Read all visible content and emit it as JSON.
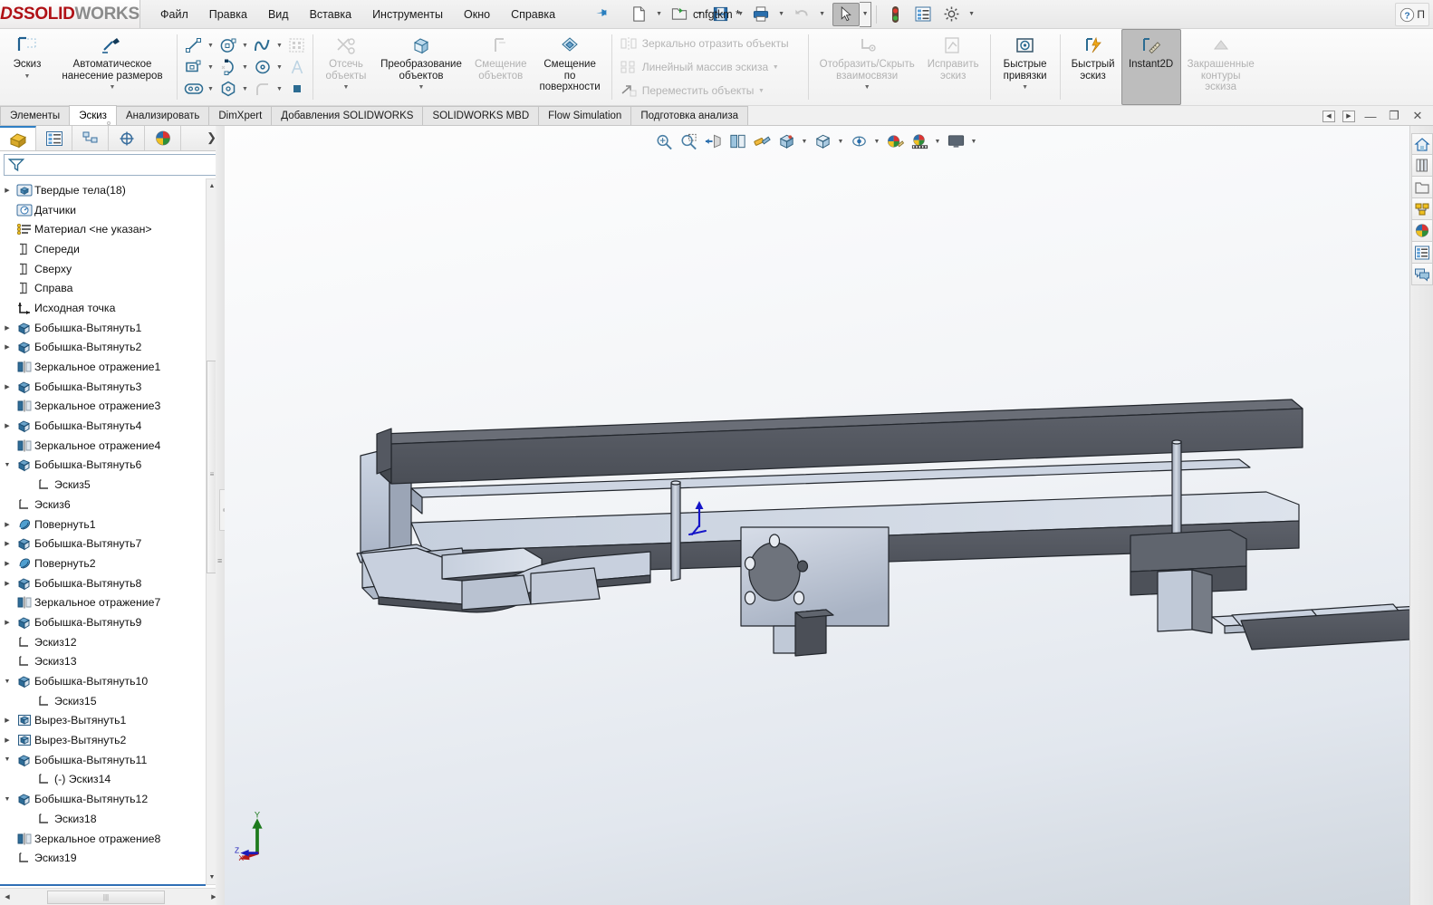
{
  "app": {
    "logo_ds": "DS",
    "logo_solid": "SOLID",
    "logo_works": "WORKS",
    "document_title": "cnfgtkm *"
  },
  "menu": {
    "items": [
      {
        "label": "Файл"
      },
      {
        "label": "Правка"
      },
      {
        "label": "Вид"
      },
      {
        "label": "Вставка"
      },
      {
        "label": "Инструменты"
      },
      {
        "label": "Окно"
      },
      {
        "label": "Справка"
      }
    ],
    "pin_icon": "pushpin-icon"
  },
  "quick_access": {
    "buttons": [
      {
        "name": "new-document-button",
        "icon": "new-file-icon",
        "caret": true
      },
      {
        "name": "open-document-button",
        "icon": "open-folder-icon",
        "caret": true
      },
      {
        "name": "save-document-button",
        "icon": "floppy-save-icon",
        "caret": true
      },
      {
        "name": "print-button",
        "icon": "printer-icon",
        "caret": true
      },
      {
        "name": "undo-button",
        "icon": "undo-arrow-icon",
        "caret": true,
        "disabled": true
      },
      {
        "name": "select-button",
        "icon": "mouse-cursor-icon",
        "caret": true,
        "selected": true
      },
      {
        "name": "rebuild-button",
        "icon": "traffic-light-icon",
        "caret": false
      },
      {
        "name": "options-list-button",
        "icon": "list-properties-icon",
        "caret": false
      },
      {
        "name": "settings-button",
        "icon": "gear-icon",
        "caret": true
      }
    ]
  },
  "help_bar": {
    "help_icon": "question-circle-icon",
    "label": "П"
  },
  "ribbon": {
    "groups": [
      {
        "name": "sketch-group",
        "big_buttons": [
          {
            "label": "Эскиз",
            "icon": "sketch-corner-icon",
            "caret": true,
            "disabled": false
          },
          {
            "label": "Автоматическое\nнанесение размеров",
            "icon": "smart-dimension-icon",
            "caret": true,
            "disabled": false
          }
        ]
      },
      {
        "name": "sketch-entities-group",
        "icon_rows": [
          [
            {
              "icon": "line-icon",
              "caret": true
            },
            {
              "icon": "circle-icon",
              "caret": true
            },
            {
              "icon": "spline-icon",
              "caret": true
            },
            {
              "icon": "sketch-pattern-icon",
              "caret": false
            }
          ],
          [
            {
              "icon": "rectangle-icon",
              "caret": true
            },
            {
              "icon": "arc-icon",
              "caret": true
            },
            {
              "icon": "ellipse-icon",
              "caret": true
            },
            {
              "icon": "text-icon",
              "caret": false
            }
          ],
          [
            {
              "icon": "slot-icon",
              "caret": true
            },
            {
              "icon": "polygon-icon",
              "caret": true
            },
            {
              "icon": "fillet-icon",
              "caret": true
            },
            {
              "icon": "point-icon",
              "caret": false
            }
          ]
        ]
      },
      {
        "name": "trim-group",
        "big_buttons": [
          {
            "label": "Отсечь\nобъекты",
            "icon": "trim-entities-icon",
            "caret": true,
            "disabled": true
          },
          {
            "label": "Преобразование\nобъектов",
            "icon": "convert-entities-icon",
            "caret": true,
            "disabled": false
          },
          {
            "label": "Смещение\nобъектов",
            "icon": "offset-entities-icon",
            "caret": false,
            "disabled": true
          },
          {
            "label": "Смещение\nпо\nповерхности",
            "icon": "offset-on-surface-icon",
            "caret": false,
            "disabled": false
          }
        ]
      },
      {
        "name": "pattern-group",
        "label_rows": [
          {
            "label": "Зеркально отразить объекты",
            "icon": "mirror-entities-icon",
            "caret": false,
            "disabled": true
          },
          {
            "label": "Линейный массив эскиза",
            "icon": "linear-pattern-icon",
            "caret": true,
            "disabled": true
          },
          {
            "label": "Переместить объекты",
            "icon": "move-entities-icon",
            "caret": true,
            "disabled": true
          }
        ]
      },
      {
        "name": "relations-group",
        "big_buttons": [
          {
            "label": "Отобразить/Скрыть\nвзаимосвязи",
            "icon": "display-relations-icon",
            "caret": true,
            "disabled": true
          },
          {
            "label": "Исправить\nэскиз",
            "icon": "repair-sketch-icon",
            "caret": false,
            "disabled": true
          }
        ]
      },
      {
        "name": "snaps-group",
        "big_buttons": [
          {
            "label": "Быстрые\nпривязки",
            "icon": "quick-snaps-icon",
            "caret": true,
            "disabled": false
          }
        ]
      },
      {
        "name": "instant-group",
        "big_buttons": [
          {
            "label": "Быстрый\nэскиз",
            "icon": "rapid-sketch-icon",
            "caret": false,
            "disabled": false
          },
          {
            "label": "Instant2D",
            "icon": "instant2d-icon",
            "caret": false,
            "disabled": false,
            "selected": true
          },
          {
            "label": "Закрашенные\nконтуры\nэскиза",
            "icon": "shaded-sketch-contours-icon",
            "caret": false,
            "disabled": true
          }
        ]
      }
    ]
  },
  "command_tabs": {
    "items": [
      {
        "label": "Элементы",
        "active": false
      },
      {
        "label": "Эскиз",
        "active": true
      },
      {
        "label": "Анализировать",
        "active": false
      },
      {
        "label": "DimXpert",
        "active": false
      },
      {
        "label": "Добавления SOLIDWORKS",
        "active": false
      },
      {
        "label": "SOLIDWORKS MBD",
        "active": false
      },
      {
        "label": "Flow Simulation",
        "active": false
      },
      {
        "label": "Подготовка анализа",
        "active": false
      }
    ],
    "window_controls": [
      {
        "name": "prev-arrow-button",
        "glyph": "◀"
      },
      {
        "name": "next-arrow-button",
        "glyph": "▶"
      },
      {
        "name": "minimize-button",
        "glyph": "—"
      },
      {
        "name": "restore-button",
        "glyph": "❐"
      },
      {
        "name": "close-button",
        "glyph": "✕"
      }
    ]
  },
  "feature_manager": {
    "tabs": [
      {
        "name": "feature-tree-tab",
        "icon": "feature-tree-icon",
        "active": true
      },
      {
        "name": "property-manager-tab",
        "icon": "property-manager-icon",
        "active": false
      },
      {
        "name": "configuration-manager-tab",
        "icon": "configuration-manager-icon",
        "active": false
      },
      {
        "name": "dimxpert-manager-tab",
        "icon": "dimxpert-manager-icon",
        "active": false
      },
      {
        "name": "display-manager-tab",
        "icon": "display-manager-icon",
        "active": false
      }
    ],
    "filter_icon": "filter-funnel-icon",
    "filter_placeholder": "",
    "tree": [
      {
        "label": "Твердые тела(18)",
        "icon": "solid-bodies-folder-icon",
        "arrow": "collapsed",
        "indent": 0
      },
      {
        "label": "Датчики",
        "icon": "sensors-folder-icon",
        "arrow": "none",
        "indent": 0
      },
      {
        "label": "Материал <не указан>",
        "icon": "material-icon",
        "arrow": "none",
        "indent": 0
      },
      {
        "label": "Спереди",
        "icon": "plane-icon",
        "arrow": "none",
        "indent": 0
      },
      {
        "label": "Сверху",
        "icon": "plane-icon",
        "arrow": "none",
        "indent": 0
      },
      {
        "label": "Справа",
        "icon": "plane-icon",
        "arrow": "none",
        "indent": 0
      },
      {
        "label": "Исходная точка",
        "icon": "origin-icon",
        "arrow": "none",
        "indent": 0
      },
      {
        "label": "Бобышка-Вытянуть1",
        "icon": "boss-extrude-icon",
        "arrow": "collapsed",
        "indent": 0
      },
      {
        "label": "Бобышка-Вытянуть2",
        "icon": "boss-extrude-icon",
        "arrow": "collapsed",
        "indent": 0
      },
      {
        "label": "Зеркальное отражение1",
        "icon": "mirror-feature-icon",
        "arrow": "none",
        "indent": 0
      },
      {
        "label": "Бобышка-Вытянуть3",
        "icon": "boss-extrude-icon",
        "arrow": "collapsed",
        "indent": 0
      },
      {
        "label": "Зеркальное отражение3",
        "icon": "mirror-feature-icon",
        "arrow": "none",
        "indent": 0
      },
      {
        "label": "Бобышка-Вытянуть4",
        "icon": "boss-extrude-icon",
        "arrow": "collapsed",
        "indent": 0
      },
      {
        "label": "Зеркальное отражение4",
        "icon": "mirror-feature-icon",
        "arrow": "none",
        "indent": 0
      },
      {
        "label": "Бобышка-Вытянуть6",
        "icon": "boss-extrude-icon",
        "arrow": "expanded",
        "indent": 0
      },
      {
        "label": "Эскиз5",
        "icon": "sketch-icon",
        "arrow": "none",
        "indent": 1
      },
      {
        "label": "Эскиз6",
        "icon": "sketch-icon",
        "arrow": "none",
        "indent": 0
      },
      {
        "label": "Повернуть1",
        "icon": "revolve-icon",
        "arrow": "collapsed",
        "indent": 0
      },
      {
        "label": "Бобышка-Вытянуть7",
        "icon": "boss-extrude-icon",
        "arrow": "collapsed",
        "indent": 0
      },
      {
        "label": "Повернуть2",
        "icon": "revolve-icon",
        "arrow": "collapsed",
        "indent": 0
      },
      {
        "label": "Бобышка-Вытянуть8",
        "icon": "boss-extrude-icon",
        "arrow": "collapsed",
        "indent": 0
      },
      {
        "label": "Зеркальное отражение7",
        "icon": "mirror-feature-icon",
        "arrow": "none",
        "indent": 0
      },
      {
        "label": "Бобышка-Вытянуть9",
        "icon": "boss-extrude-icon",
        "arrow": "collapsed",
        "indent": 0
      },
      {
        "label": "Эскиз12",
        "icon": "sketch-icon",
        "arrow": "none",
        "indent": 0
      },
      {
        "label": "Эскиз13",
        "icon": "sketch-icon",
        "arrow": "none",
        "indent": 0
      },
      {
        "label": "Бобышка-Вытянуть10",
        "icon": "boss-extrude-icon",
        "arrow": "expanded",
        "indent": 0
      },
      {
        "label": "Эскиз15",
        "icon": "sketch-icon",
        "arrow": "none",
        "indent": 1
      },
      {
        "label": "Вырез-Вытянуть1",
        "icon": "cut-extrude-icon",
        "arrow": "collapsed",
        "indent": 0
      },
      {
        "label": "Вырез-Вытянуть2",
        "icon": "cut-extrude-icon",
        "arrow": "collapsed",
        "indent": 0
      },
      {
        "label": "Бобышка-Вытянуть11",
        "icon": "boss-extrude-icon",
        "arrow": "expanded",
        "indent": 0
      },
      {
        "label": "(-) Эскиз14",
        "icon": "sketch-icon",
        "arrow": "none",
        "indent": 1
      },
      {
        "label": "Бобышка-Вытянуть12",
        "icon": "boss-extrude-icon",
        "arrow": "expanded",
        "indent": 0
      },
      {
        "label": "Эскиз18",
        "icon": "sketch-icon",
        "arrow": "none",
        "indent": 1
      },
      {
        "label": "Зеркальное отражение8",
        "icon": "mirror-feature-icon",
        "arrow": "none",
        "indent": 0
      },
      {
        "label": "Эскиз19",
        "icon": "sketch-icon",
        "arrow": "none",
        "indent": 0
      }
    ]
  },
  "view_toolbar": {
    "buttons": [
      {
        "name": "zoom-to-fit-button",
        "icon": "zoom-to-fit-icon",
        "caret": false
      },
      {
        "name": "zoom-to-area-button",
        "icon": "zoom-to-area-icon",
        "caret": false
      },
      {
        "name": "section-view-button",
        "icon": "section-view-icon",
        "caret": false
      },
      {
        "name": "view-orientation-button",
        "icon": "view-orientation-icon",
        "caret": false
      },
      {
        "name": "appearance-button",
        "icon": "appearance-paint-icon",
        "caret": false
      },
      {
        "name": "display-style-button",
        "icon": "display-style-icon",
        "caret": true
      },
      {
        "name": "hide-show-items-button",
        "icon": "hide-show-cube-icon",
        "caret": true
      },
      {
        "name": "view-settings-button",
        "icon": "view-settings-eye-icon",
        "caret": true
      },
      {
        "name": "edit-appearance-button",
        "icon": "edit-appearance-icon",
        "caret": false
      },
      {
        "name": "apply-scene-button",
        "icon": "apply-scene-icon",
        "caret": true
      },
      {
        "name": "viewport-button",
        "icon": "viewport-monitor-icon",
        "caret": true
      }
    ]
  },
  "right_toolbar": {
    "buttons": [
      {
        "name": "solidworks-resources-button",
        "icon": "home-house-icon"
      },
      {
        "name": "design-library-button",
        "icon": "design-library-books-icon"
      },
      {
        "name": "file-explorer-button",
        "icon": "folder-icon"
      },
      {
        "name": "view-palette-button",
        "icon": "view-palette-icon"
      },
      {
        "name": "appearances-scenes-button",
        "icon": "appearances-sphere-icon"
      },
      {
        "name": "custom-properties-button",
        "icon": "custom-properties-list-icon"
      },
      {
        "name": "markup-button",
        "icon": "speech-bubbles-icon"
      }
    ]
  },
  "triad": {
    "y_label": "Y",
    "x_label": "X",
    "z_label": "Z",
    "colors": {
      "y": "#1c7a1c",
      "x": "#c01818",
      "z": "#1a1ab8"
    }
  },
  "colors": {
    "accent": "#2f7fc4",
    "brand_red": "#b01116",
    "tab_active_bg": "#ffffff",
    "model_dark": "#55585f",
    "model_light": "#b9c1d0",
    "graphics_bg_top": "#fdfdfd",
    "graphics_bg_bottom": "#cfd6de"
  }
}
